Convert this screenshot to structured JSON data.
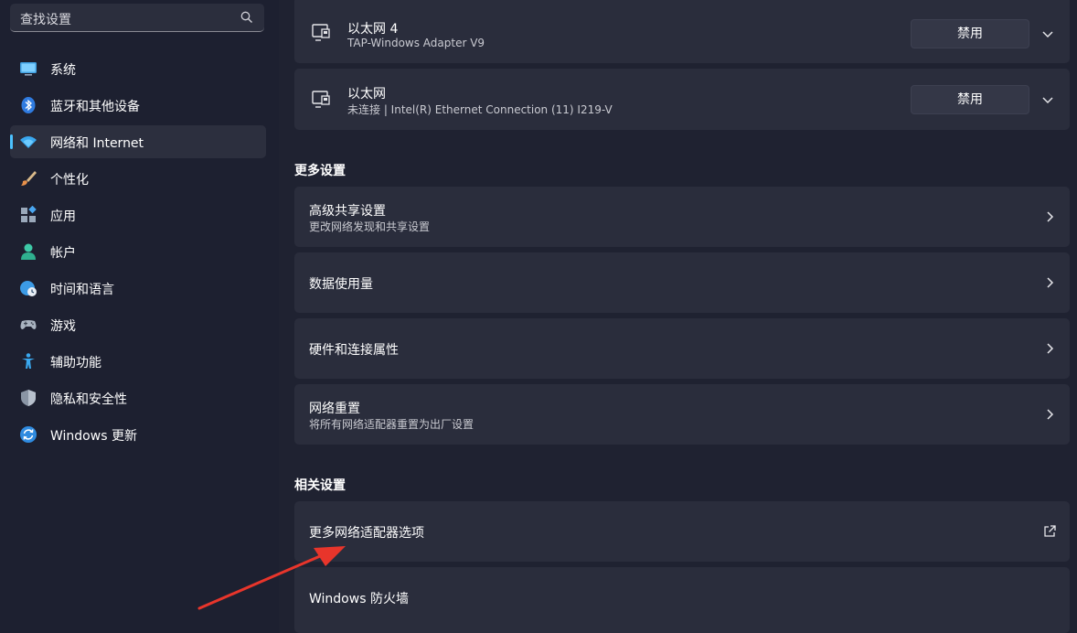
{
  "search": {
    "placeholder": "查找设置",
    "icon": "search-icon"
  },
  "sidebar": {
    "items": [
      {
        "label": "系统",
        "icon": "monitor-icon",
        "active": false
      },
      {
        "label": "蓝牙和其他设备",
        "icon": "bluetooth-icon",
        "active": false
      },
      {
        "label": "网络和 Internet",
        "icon": "wifi-icon",
        "active": true
      },
      {
        "label": "个性化",
        "icon": "brush-icon",
        "active": false
      },
      {
        "label": "应用",
        "icon": "apps-icon",
        "active": false
      },
      {
        "label": "帐户",
        "icon": "person-icon",
        "active": false
      },
      {
        "label": "时间和语言",
        "icon": "globe-clock-icon",
        "active": false
      },
      {
        "label": "游戏",
        "icon": "gamepad-icon",
        "active": false
      },
      {
        "label": "辅助功能",
        "icon": "accessibility-icon",
        "active": false
      },
      {
        "label": "隐私和安全性",
        "icon": "shield-icon",
        "active": false
      },
      {
        "label": "Windows 更新",
        "icon": "refresh-icon",
        "active": false
      }
    ],
    "accent_color": "#4cc2ff"
  },
  "adapters": [
    {
      "name": "以太网 4",
      "description": "TAP-Windows Adapter V9",
      "button": "禁用"
    },
    {
      "name": "以太网",
      "description": "未连接 | Intel(R) Ethernet Connection (11) I219-V",
      "button": "禁用"
    }
  ],
  "more_settings": {
    "title": "更多设置",
    "items": [
      {
        "title": "高级共享设置",
        "subtitle": "更改网络发现和共享设置"
      },
      {
        "title": "数据使用量",
        "subtitle": ""
      },
      {
        "title": "硬件和连接属性",
        "subtitle": ""
      },
      {
        "title": "网络重置",
        "subtitle": "将所有网络适配器重置为出厂设置"
      }
    ]
  },
  "related_settings": {
    "title": "相关设置",
    "items": [
      {
        "title": "更多网络适配器选项",
        "icon": "external-link-icon"
      },
      {
        "title": "Windows 防火墙",
        "icon": ""
      }
    ]
  },
  "annotation": {
    "arrow_color": "#e8352b"
  }
}
